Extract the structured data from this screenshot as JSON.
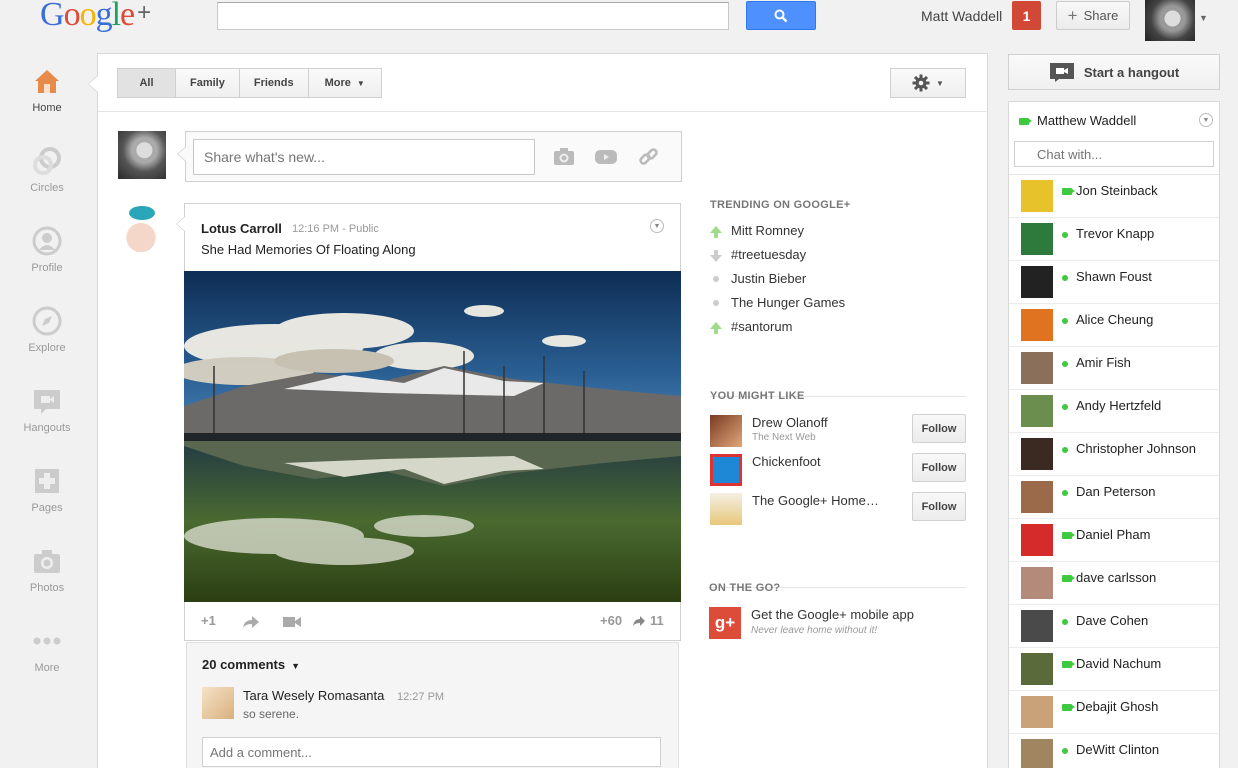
{
  "app": {
    "logo_text": "Google+"
  },
  "header": {
    "search_placeholder": "",
    "user_name": "Matt Waddell",
    "notification_count": "1",
    "share_label": "Share"
  },
  "nav": {
    "items": [
      {
        "label": "Home",
        "icon": "home-icon",
        "active": true
      },
      {
        "label": "Circles",
        "icon": "circles-icon"
      },
      {
        "label": "Profile",
        "icon": "profile-icon"
      },
      {
        "label": "Explore",
        "icon": "explore-icon"
      },
      {
        "label": "Hangouts",
        "icon": "hangouts-icon"
      },
      {
        "label": "Pages",
        "icon": "pages-icon"
      },
      {
        "label": "Photos",
        "icon": "photos-icon"
      },
      {
        "label": "More",
        "icon": "more-icon"
      }
    ]
  },
  "stream": {
    "tabs": [
      {
        "label": "All"
      },
      {
        "label": "Family"
      },
      {
        "label": "Friends"
      },
      {
        "label": "More"
      }
    ],
    "share_placeholder": "Share what's new...",
    "post": {
      "author": "Lotus Carroll",
      "time": "12:16 PM",
      "visibility": "Public",
      "text": "She Had Memories Of Floating Along",
      "plus_one": "+1",
      "plus_count": "+60",
      "share_count": "11",
      "comments_label": "20 comments",
      "comment": {
        "author": "Tara Wesely Romasanta",
        "time": "12:27 PM",
        "text": "so serene."
      },
      "add_comment_placeholder": "Add a comment..."
    }
  },
  "sidebar": {
    "trending_title": "TRENDING ON GOOGLE+",
    "trending": [
      {
        "label": "Mitt Romney",
        "trend": "up"
      },
      {
        "label": "#treetuesday",
        "trend": "down"
      },
      {
        "label": "Justin Bieber",
        "trend": "none"
      },
      {
        "label": "The Hunger Games",
        "trend": "none"
      },
      {
        "label": "#santorum",
        "trend": "up"
      }
    ],
    "like_title": "YOU MIGHT LIKE",
    "suggestions": [
      {
        "name": "Drew Olanoff",
        "sub": "The Next Web",
        "follow": "Follow"
      },
      {
        "name": "Chickenfoot",
        "sub": "",
        "follow": "Follow"
      },
      {
        "name": "The Google+ Home…",
        "sub": "",
        "follow": "Follow"
      }
    ],
    "onthego_title": "ON THE GO?",
    "mobile_title": "Get the Google+ mobile app",
    "mobile_sub": "Never leave home without it!",
    "mobile_icon_text": "g+"
  },
  "chat": {
    "hangout_label": "Start a hangout",
    "me": "Matthew Waddell",
    "search_placeholder": "Chat with...",
    "contacts": [
      {
        "name": "Jon Steinback",
        "status": "video",
        "color": "#e8c22a"
      },
      {
        "name": "Trevor Knapp",
        "status": "online",
        "color": "#2d7a3c"
      },
      {
        "name": "Shawn Foust",
        "status": "online",
        "color": "#222222"
      },
      {
        "name": "Alice Cheung",
        "status": "online",
        "color": "#e0731f"
      },
      {
        "name": "Amir Fish",
        "status": "online",
        "color": "#8a6f5a"
      },
      {
        "name": "Andy Hertzfeld",
        "status": "online",
        "color": "#6b8e4e"
      },
      {
        "name": "Christopher Johnson",
        "status": "online",
        "color": "#3a2a22"
      },
      {
        "name": "Dan Peterson",
        "status": "online",
        "color": "#9a6a4a"
      },
      {
        "name": "Daniel Pham",
        "status": "video",
        "color": "#d62b2b"
      },
      {
        "name": "dave carlsson",
        "status": "video",
        "color": "#b48a7a"
      },
      {
        "name": "Dave Cohen",
        "status": "online",
        "color": "#4a4a4a"
      },
      {
        "name": "David Nachum",
        "status": "video",
        "color": "#5a6a3a"
      },
      {
        "name": "Debajit Ghosh",
        "status": "video",
        "color": "#c9a27a"
      },
      {
        "name": "DeWitt Clinton",
        "status": "online",
        "color": "#a08560"
      }
    ]
  },
  "colors": {
    "accent_blue": "#4d90fe",
    "notification_red": "#d14836",
    "online_green": "#3ec93e"
  }
}
